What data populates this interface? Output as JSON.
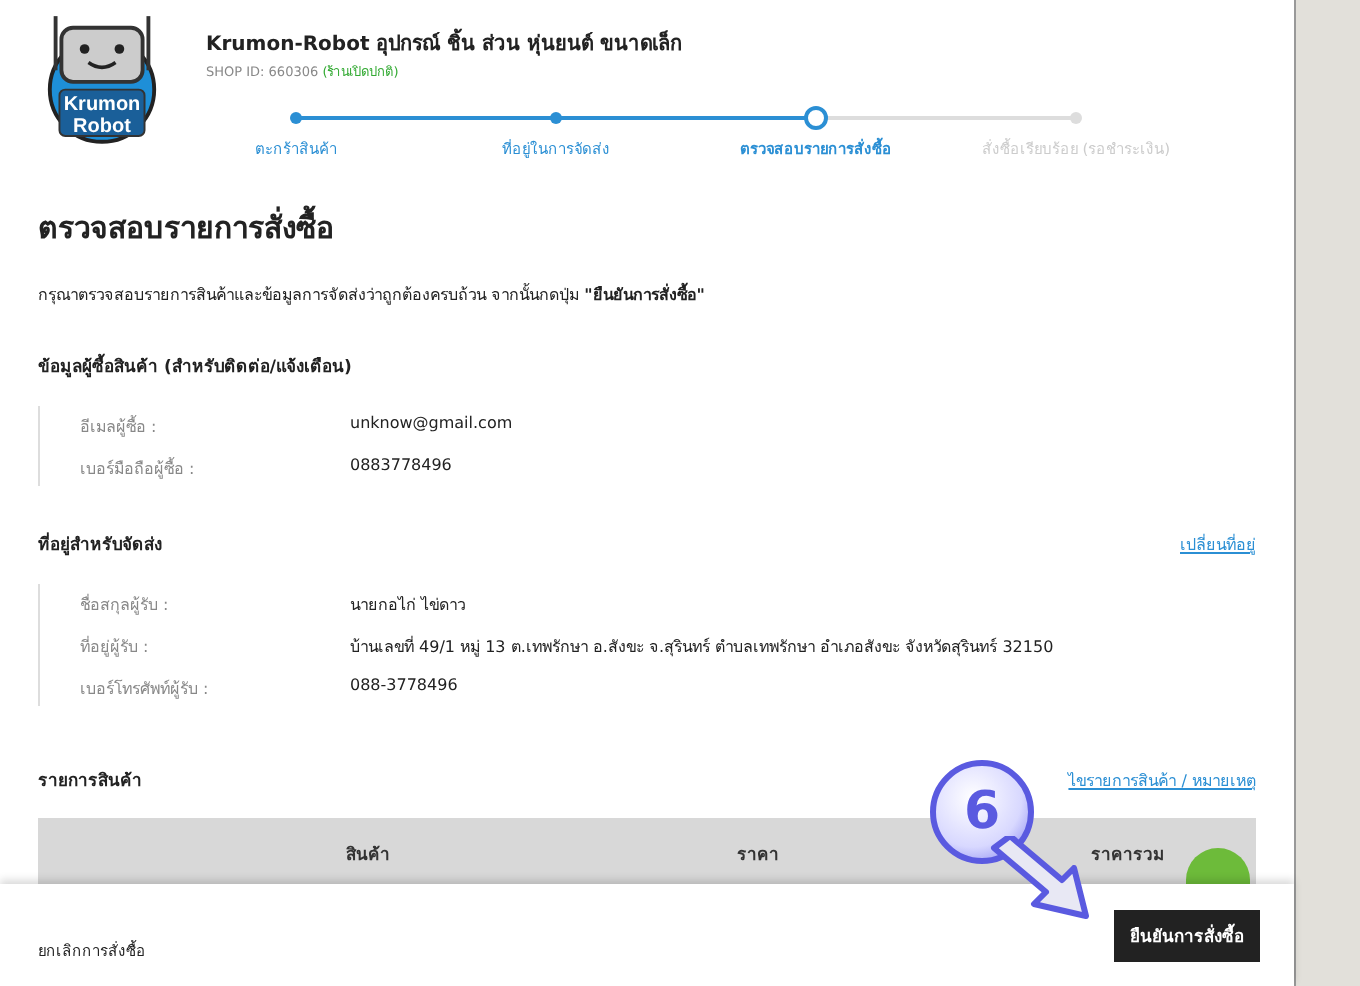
{
  "shop": {
    "name": "Krumon-Robot อุปกรณ์ ชิ้น ส่วน หุ่นยนต์ ขนาดเล็ก",
    "shop_id": "SHOP ID: 660306",
    "status": "(ร้านเปิดปกติ)",
    "logo_text": [
      "Krumon",
      "Robot"
    ]
  },
  "steps": [
    {
      "label": "ตะกร้าสินค้า",
      "completed": true,
      "selected": false
    },
    {
      "label": "ที่อยู่ในการจัดส่ง",
      "completed": true,
      "selected": false
    },
    {
      "label": "ตรวจสอบรายการสั่งซื้อ",
      "completed": true,
      "selected": true
    },
    {
      "label": "สั่งซื้อเรียบร้อย (รอชำระเงิน)",
      "completed": false,
      "selected": false
    }
  ],
  "heading": "ตรวจสอบรายการสั่งซื้อ",
  "intro": "กรุณาตรวจสอบรายการสินค้าและข้อมูลการจัดส่งว่าถูกต้องครบถ้วน จากนั้นกดปุ่ม **\"ยืนยันการสั่งซื้อ\"**",
  "buyer": {
    "title": "ข้อมูลผู้ซื้อสินค้า (สำหรับติดต่อ/แจ้งเตือน)",
    "fields": [
      {
        "label": "อีเมลผู้ซื้อ :",
        "value": "unknow@gmail.com"
      },
      {
        "label": "เบอร์มือถือผู้ซื้อ :",
        "value": "0883778496"
      }
    ]
  },
  "shipping": {
    "title": "ที่อยู่สำหรับจัดส่ง",
    "link": "เปลี่ยนที่อยู่",
    "fields": [
      {
        "label": "ชื่อสกุลผู้รับ :",
        "value": "นายกอไก่ ไข่ดาว"
      },
      {
        "label": "ที่อยู่ผู้รับ :",
        "value": "บ้านเลขที่ 49/1 หมู่ 13 ต.เทพรักษา อ.สังขะ จ.สุรินทร์  ตำบลเทพรักษา  อำเภอสังขะ  จังหวัดสุรินทร์  32150"
      },
      {
        "label": "เบอร์โทรศัพท์ผู้รับ :",
        "value": "088-3778496"
      }
    ]
  },
  "items": {
    "title": "รายการสินค้า",
    "link": "ไขรายการสินค้า / หมายเหตุ",
    "columns": [
      "สินค้า",
      "ราคา",
      "ราคารวม"
    ]
  },
  "annotation": {
    "number": "6"
  },
  "footer": {
    "cancel": "ยกเลิกการสั่งซื้อ",
    "confirm": "ยืนยันการสั่งซื้อ"
  }
}
